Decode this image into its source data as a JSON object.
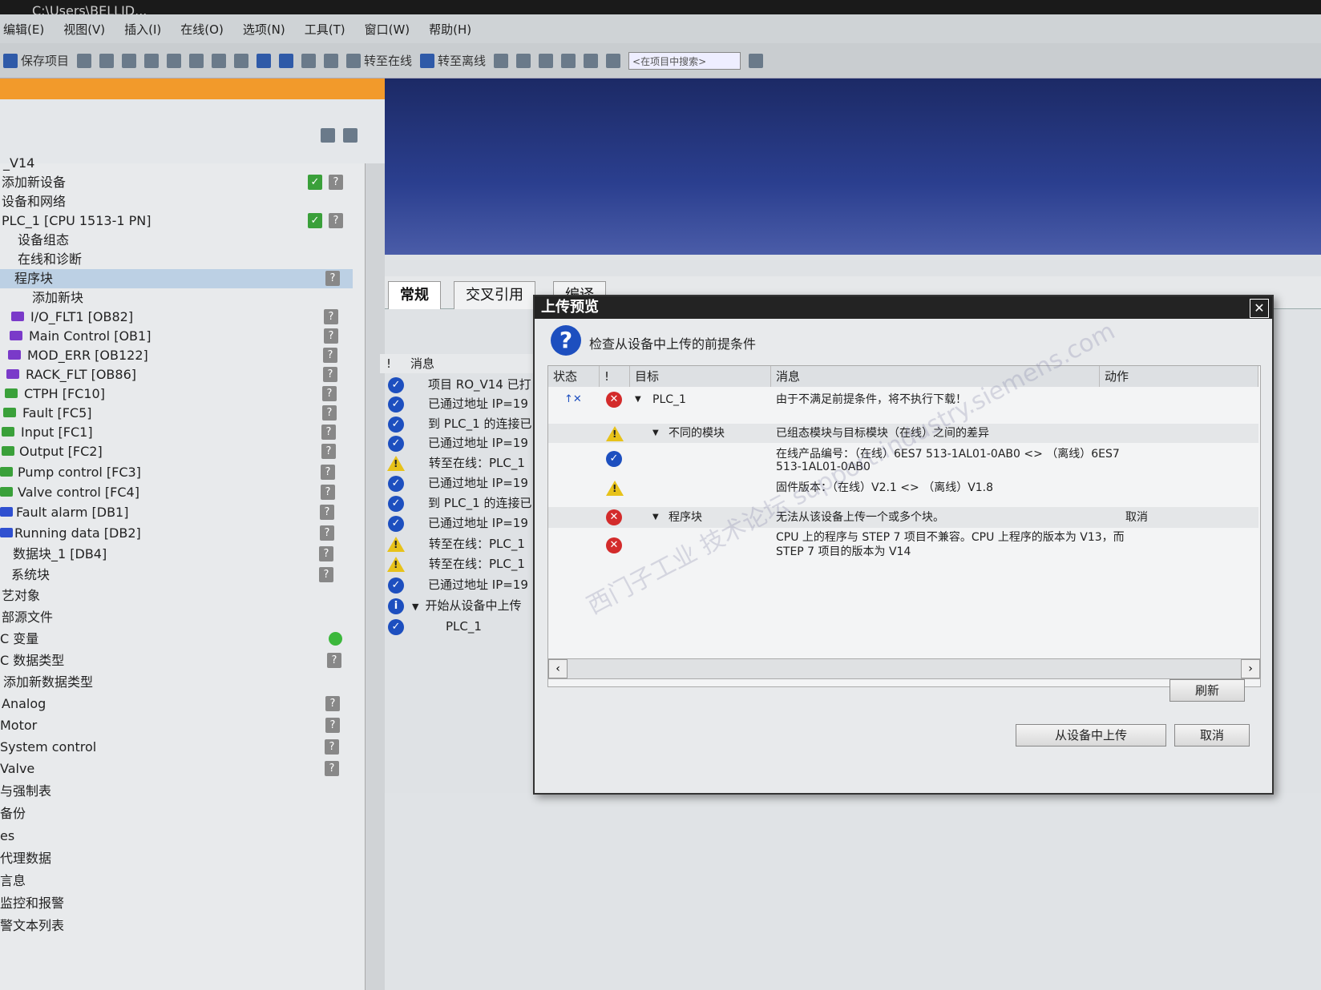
{
  "window": {
    "title": "C:\\Users\\BELLID..."
  },
  "menu": [
    "编辑(E)",
    "视图(V)",
    "插入(I)",
    "在线(O)",
    "选项(N)",
    "工具(T)",
    "窗口(W)",
    "帮助(H)"
  ],
  "toolbar": {
    "save_label": "保存项目",
    "go_online_label": "转至在线",
    "go_offline_label": "转至离线",
    "search_placeholder": "<在项目中搜索>"
  },
  "tree": {
    "project": "_V14",
    "items": [
      {
        "label": "添加新设备",
        "status": "ok"
      },
      {
        "label": "设备和网络",
        "status": ""
      },
      {
        "label": "PLC_1 [CPU 1513-1 PN]",
        "status": "ok"
      },
      {
        "label": "设备组态",
        "status": ""
      },
      {
        "label": "在线和诊断",
        "status": ""
      },
      {
        "label": "程序块",
        "status": "q",
        "selected": true
      },
      {
        "label": "添加新块",
        "status": ""
      },
      {
        "label": "I/O_FLT1 [OB82]",
        "status": "q",
        "type": "ob"
      },
      {
        "label": "Main Control [OB1]",
        "status": "q",
        "type": "ob"
      },
      {
        "label": "MOD_ERR [OB122]",
        "status": "q",
        "type": "ob"
      },
      {
        "label": "RACK_FLT [OB86]",
        "status": "q",
        "type": "ob"
      },
      {
        "label": "CTPH [FC10]",
        "status": "q",
        "type": "fc"
      },
      {
        "label": "Fault [FC5]",
        "status": "q",
        "type": "fc"
      },
      {
        "label": "Input [FC1]",
        "status": "q",
        "type": "fc"
      },
      {
        "label": "Output [FC2]",
        "status": "q",
        "type": "fc"
      },
      {
        "label": "Pump control [FC3]",
        "status": "q",
        "type": "fc"
      },
      {
        "label": "Valve control [FC4]",
        "status": "q",
        "type": "fc"
      },
      {
        "label": "Fault alarm [DB1]",
        "status": "q",
        "type": "db"
      },
      {
        "label": "Running data [DB2]",
        "status": "q",
        "type": "db"
      },
      {
        "label": "数据块_1 [DB4]",
        "status": "q",
        "type": "db"
      },
      {
        "label": "系统块",
        "status": "q"
      },
      {
        "label": "艺对象",
        "status": ""
      },
      {
        "label": "部源文件",
        "status": ""
      },
      {
        "label": "C 变量",
        "status": "green"
      },
      {
        "label": "C 数据类型",
        "status": "q"
      },
      {
        "label": "添加新数据类型",
        "status": ""
      },
      {
        "label": "Analog",
        "status": "q"
      },
      {
        "label": "Motor",
        "status": "q"
      },
      {
        "label": "System control",
        "status": "q"
      },
      {
        "label": "Valve",
        "status": "q"
      },
      {
        "label": "与强制表",
        "status": ""
      },
      {
        "label": "备份",
        "status": ""
      },
      {
        "label": "es",
        "status": ""
      },
      {
        "label": "代理数据",
        "status": ""
      },
      {
        "label": "言息",
        "status": ""
      },
      {
        "label": "监控和报警",
        "status": ""
      },
      {
        "label": "警文本列表",
        "status": ""
      }
    ]
  },
  "inspector": {
    "tabs": [
      "常规",
      "交叉引用",
      "编译"
    ],
    "column_message": "消息",
    "rows": [
      {
        "icon": "check",
        "text": "项目 RO_V14 已打"
      },
      {
        "icon": "check",
        "text": "已通过地址 IP=19"
      },
      {
        "icon": "check",
        "text": "到 PLC_1 的连接已"
      },
      {
        "icon": "check",
        "text": "已通过地址 IP=19"
      },
      {
        "icon": "warn",
        "text": "转至在线：PLC_1"
      },
      {
        "icon": "check",
        "text": "已通过地址 IP=19"
      },
      {
        "icon": "check",
        "text": "到 PLC_1 的连接已"
      },
      {
        "icon": "check",
        "text": "已通过地址 IP=19"
      },
      {
        "icon": "warn",
        "text": "转至在线：PLC_1"
      },
      {
        "icon": "warn",
        "text": "转至在线：PLC_1"
      },
      {
        "icon": "check",
        "text": "已通过地址 IP=19"
      },
      {
        "icon": "info",
        "text": "开始从设备中上传"
      },
      {
        "icon": "check",
        "text": "PLC_1"
      }
    ]
  },
  "dialog": {
    "title": "上传预览",
    "subtitle": "检查从设备中上传的前提条件",
    "columns": {
      "status": "状态",
      "excl": "!",
      "target": "目标",
      "message": "消息",
      "action": "动作"
    },
    "rows": [
      {
        "icon": "err",
        "target": "PLC_1",
        "message": "由于不满足前提条件，将不执行下载！",
        "action": "",
        "shade": false
      },
      {
        "icon": "warn",
        "target": "不同的模块",
        "message": "已组态模块与目标模块（在线）之间的差异",
        "action": "",
        "shade": true
      },
      {
        "icon": "check",
        "target": "",
        "message": "在线产品编号：（在线）6ES7 513-1AL01-0AB0 <> （离线）6ES7",
        "message2": "513-1AL01-0AB0",
        "action": "",
        "shade": false
      },
      {
        "icon": "warn",
        "target": "",
        "message": "固件版本：（在线）V2.1 <> （离线）V1.8",
        "action": "",
        "shade": false
      },
      {
        "icon": "err",
        "target": "程序块",
        "message": "无法从该设备上传一个或多个块。",
        "action": "取消",
        "shade": true
      },
      {
        "icon": "err",
        "target": "",
        "message": "CPU 上的程序与 STEP 7 项目不兼容。CPU 上程序的版本为 V13，而",
        "message2": "STEP 7 项目的版本为 V14",
        "action": "",
        "shade": false
      }
    ],
    "refresh_label": "刷新",
    "upload_label": "从设备中上传",
    "cancel_label": "取消"
  },
  "watermark": "西门子工业  技术论坛  support.industry.siemens.com"
}
